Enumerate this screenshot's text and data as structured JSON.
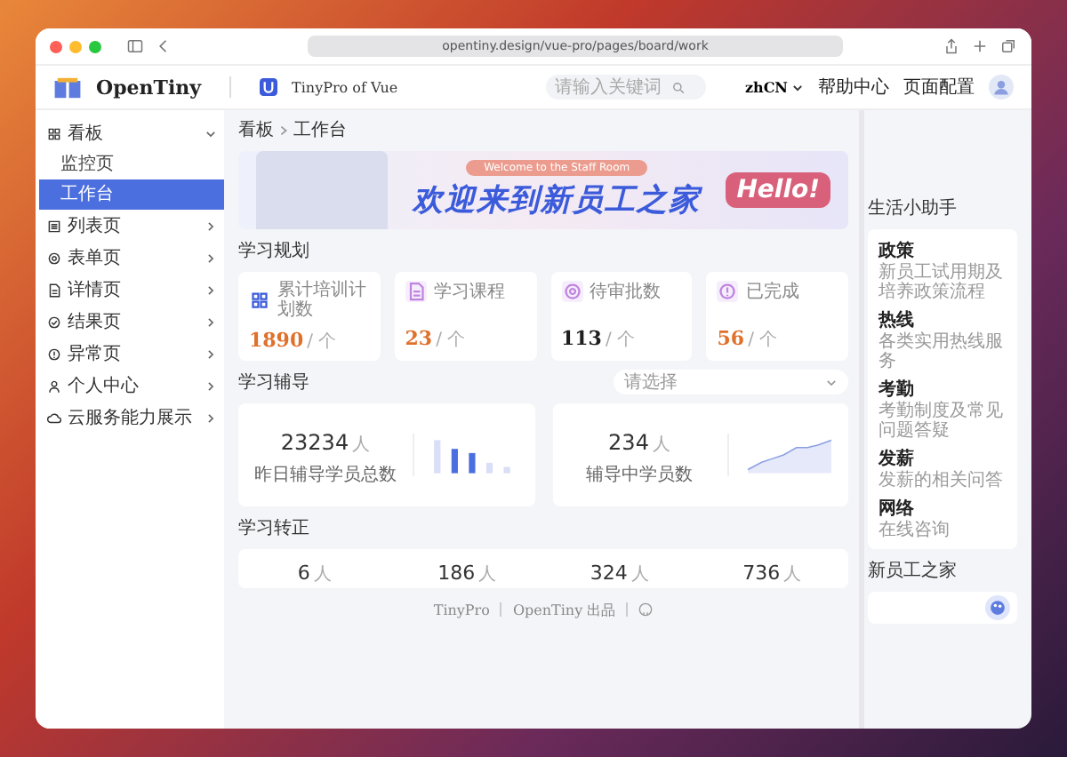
{
  "browser": {
    "url": "opentiny.design/vue-pro/pages/board/work"
  },
  "header": {
    "logo": "OpenTiny",
    "product": "TinyPro of Vue",
    "search": {
      "placeholder": "请输入关键词"
    },
    "language": "zhCN",
    "links": [
      "帮助中心",
      "页面配置"
    ]
  },
  "sidebar": {
    "items": [
      {
        "label": "看板",
        "expanded": true,
        "children": [
          {
            "label": "监控页",
            "selected": false
          },
          {
            "label": "工作台",
            "selected": true
          }
        ]
      },
      {
        "label": "列表页",
        "expanded": false
      },
      {
        "label": "表单页",
        "expanded": false
      },
      {
        "label": "详情页",
        "expanded": false
      },
      {
        "label": "结果页",
        "expanded": false
      },
      {
        "label": "异常页",
        "expanded": false
      },
      {
        "label": "个人中心",
        "expanded": false
      },
      {
        "label": "云服务能力展示",
        "expanded": false
      }
    ]
  },
  "breadcrumb": [
    "看板",
    "工作台"
  ],
  "banner": {
    "tag": "Welcome to the Staff Room",
    "title": "欢迎来到新员工之家",
    "badge": "Hello!"
  },
  "plan": {
    "title": "学习规划",
    "cards": [
      {
        "label": "累计培训计划数",
        "value": "1890",
        "unit": "/ 个",
        "color": "#e0712c"
      },
      {
        "label": "学习课程",
        "value": "23",
        "unit": "/ 个",
        "color": "#e0712c"
      },
      {
        "label": "待审批数",
        "value": "113",
        "unit": "/ 个",
        "color": "#1f1f1f"
      },
      {
        "label": "已完成",
        "value": "56",
        "unit": "/ 个",
        "color": "#e0712c"
      }
    ]
  },
  "coaching": {
    "title": "学习辅导",
    "select": {
      "placeholder": "请选择"
    },
    "cards": [
      {
        "kind": "bars",
        "value": "23234",
        "unit": "人",
        "label": "昨日辅导学员总数"
      },
      {
        "kind": "area",
        "value": "234",
        "unit": "人",
        "label": "辅导中学员数"
      }
    ]
  },
  "transfer": {
    "title": "学习转正",
    "items": [
      {
        "value": "6",
        "unit": "人"
      },
      {
        "value": "186",
        "unit": "人"
      },
      {
        "value": "324",
        "unit": "人"
      },
      {
        "value": "736",
        "unit": "人"
      }
    ]
  },
  "assistant": {
    "title": "生活小助手",
    "items": [
      {
        "title": "政策",
        "text": "新员工试用期及培养政策流程"
      },
      {
        "title": "热线",
        "text": "各类实用热线服务"
      },
      {
        "title": "考勤",
        "text": "考勤制度及常见问题答疑"
      },
      {
        "title": "发薪",
        "text": "发薪的相关问答"
      },
      {
        "title": "网络",
        "text": "在线咨询"
      }
    ]
  },
  "home": {
    "title": "新员工之家"
  },
  "footer": {
    "links": [
      "TinyPro",
      "OpenTiny 出品"
    ]
  }
}
